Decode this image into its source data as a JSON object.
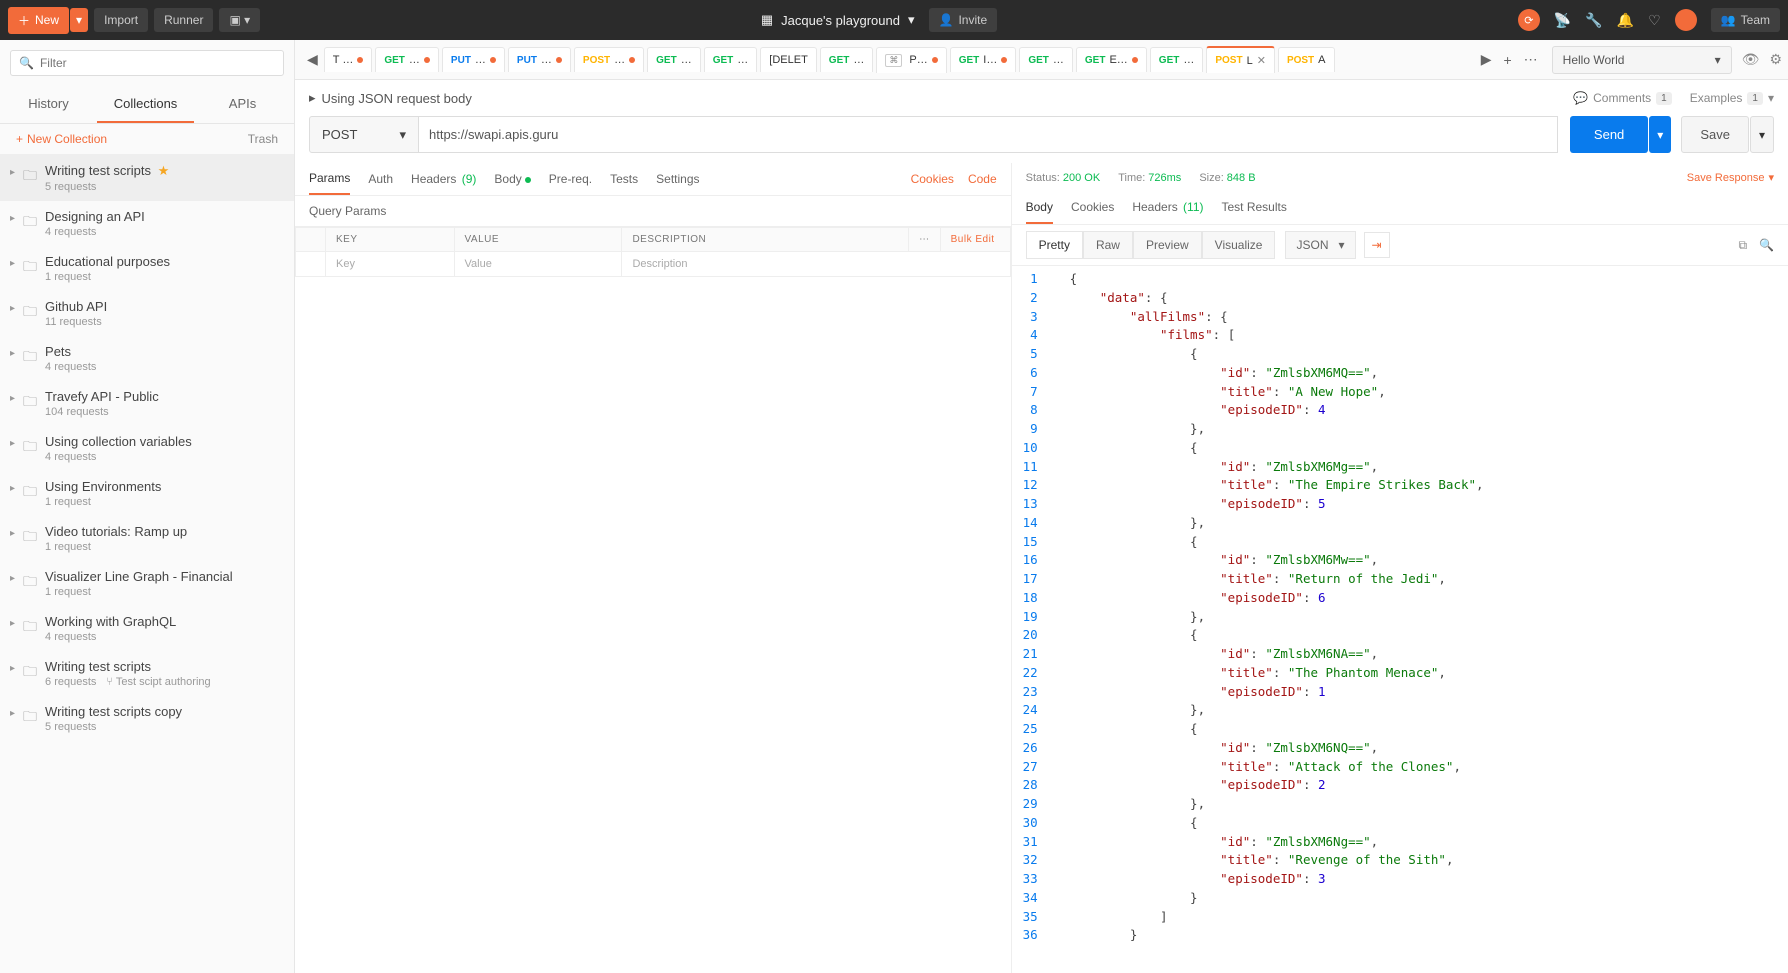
{
  "topbar": {
    "new": "New",
    "import": "Import",
    "runner": "Runner",
    "workspace": "Jacque's playground",
    "invite": "Invite",
    "team": "Team"
  },
  "sidebar": {
    "filter_ph": "Filter",
    "tabs": {
      "history": "History",
      "collections": "Collections",
      "apis": "APIs"
    },
    "new_collection": "New Collection",
    "trash": "Trash",
    "items": [
      {
        "name": "Writing test scripts",
        "sub": "5 requests",
        "star": true,
        "sel": true
      },
      {
        "name": "Designing an API",
        "sub": "4 requests"
      },
      {
        "name": "Educational purposes",
        "sub": "1 request"
      },
      {
        "name": "Github API",
        "sub": "11 requests"
      },
      {
        "name": "Pets",
        "sub": "4 requests"
      },
      {
        "name": "Travefy API - Public",
        "sub": "104 requests"
      },
      {
        "name": "Using collection variables",
        "sub": "4 requests"
      },
      {
        "name": "Using Environments",
        "sub": "1 request"
      },
      {
        "name": "Video tutorials: Ramp up",
        "sub": "1 request"
      },
      {
        "name": "Visualizer Line Graph - Financial",
        "sub": "1 request"
      },
      {
        "name": "Working with GraphQL",
        "sub": "4 requests"
      },
      {
        "name": "Writing test scripts",
        "sub": "6 requests",
        "fork": "Test scipt authoring"
      },
      {
        "name": "Writing test scripts copy",
        "sub": "5 requests"
      }
    ]
  },
  "tabs": [
    {
      "method": "NONE",
      "label": "T …",
      "dot": true
    },
    {
      "method": "GET",
      "label": "…",
      "dot": true
    },
    {
      "method": "PUT",
      "label": "…",
      "dot": true
    },
    {
      "method": "PUT",
      "label": "…",
      "dot": true
    },
    {
      "method": "POST",
      "label": "…",
      "dot": true
    },
    {
      "method": "GET",
      "label": "…"
    },
    {
      "method": "GET",
      "label": "…"
    },
    {
      "method": "DEL",
      "label": "[DELET"
    },
    {
      "method": "GET",
      "label": "…"
    },
    {
      "method": "NONE",
      "label": "P…",
      "kbd": true,
      "dot": true
    },
    {
      "method": "GET",
      "label": "I…",
      "dot": true
    },
    {
      "method": "GET",
      "label": "…"
    },
    {
      "method": "GET",
      "label": "E…",
      "dot": true
    },
    {
      "method": "GET",
      "label": "…"
    },
    {
      "method": "POST",
      "label": "L",
      "active": true,
      "close": true
    },
    {
      "method": "POST",
      "label": "A"
    }
  ],
  "env": "Hello World",
  "request": {
    "name": "Using JSON request body",
    "comments": "Comments",
    "comments_n": "1",
    "examples": "Examples",
    "examples_n": "1",
    "method": "POST",
    "url": "https://swapi.apis.guru",
    "send": "Send",
    "save": "Save",
    "tabs": {
      "params": "Params",
      "auth": "Auth",
      "headers": "Headers",
      "headers_n": "(9)",
      "body": "Body",
      "prereq": "Pre-req.",
      "tests": "Tests",
      "settings": "Settings",
      "cookies": "Cookies",
      "code": "Code"
    },
    "qparams": "Query Params",
    "th": {
      "key": "KEY",
      "value": "VALUE",
      "desc": "DESCRIPTION",
      "bulk": "Bulk Edit"
    },
    "ph": {
      "key": "Key",
      "value": "Value",
      "desc": "Description"
    }
  },
  "response": {
    "status_l": "Status:",
    "status": "200 OK",
    "time_l": "Time:",
    "time": "726ms",
    "size_l": "Size:",
    "size": "848 B",
    "save": "Save Response",
    "tabs": {
      "body": "Body",
      "cookies": "Cookies",
      "headers": "Headers",
      "headers_n": "(11)",
      "tests": "Test Results"
    },
    "views": {
      "pretty": "Pretty",
      "raw": "Raw",
      "preview": "Preview",
      "visualize": "Visualize",
      "fmt": "JSON"
    },
    "body_lines": [
      [
        [
          "brace",
          "{"
        ]
      ],
      [
        [
          "sp",
          "    "
        ],
        [
          "key",
          "\"data\""
        ],
        [
          "punc",
          ": "
        ],
        [
          "brace",
          "{"
        ]
      ],
      [
        [
          "sp",
          "        "
        ],
        [
          "key",
          "\"allFilms\""
        ],
        [
          "punc",
          ": "
        ],
        [
          "brace",
          "{"
        ]
      ],
      [
        [
          "sp",
          "            "
        ],
        [
          "key",
          "\"films\""
        ],
        [
          "punc",
          ": "
        ],
        [
          "brace",
          "["
        ]
      ],
      [
        [
          "sp",
          "                "
        ],
        [
          "brace",
          "{"
        ]
      ],
      [
        [
          "sp",
          "                    "
        ],
        [
          "key",
          "\"id\""
        ],
        [
          "punc",
          ": "
        ],
        [
          "str",
          "\"ZmlsbXM6MQ==\""
        ],
        [
          "punc",
          ","
        ]
      ],
      [
        [
          "sp",
          "                    "
        ],
        [
          "key",
          "\"title\""
        ],
        [
          "punc",
          ": "
        ],
        [
          "str",
          "\"A New Hope\""
        ],
        [
          "punc",
          ","
        ]
      ],
      [
        [
          "sp",
          "                    "
        ],
        [
          "key",
          "\"episodeID\""
        ],
        [
          "punc",
          ": "
        ],
        [
          "num",
          "4"
        ]
      ],
      [
        [
          "sp",
          "                "
        ],
        [
          "brace",
          "}"
        ],
        [
          "punc",
          ","
        ]
      ],
      [
        [
          "sp",
          "                "
        ],
        [
          "brace",
          "{"
        ]
      ],
      [
        [
          "sp",
          "                    "
        ],
        [
          "key",
          "\"id\""
        ],
        [
          "punc",
          ": "
        ],
        [
          "str",
          "\"ZmlsbXM6Mg==\""
        ],
        [
          "punc",
          ","
        ]
      ],
      [
        [
          "sp",
          "                    "
        ],
        [
          "key",
          "\"title\""
        ],
        [
          "punc",
          ": "
        ],
        [
          "str",
          "\"The Empire Strikes Back\""
        ],
        [
          "punc",
          ","
        ]
      ],
      [
        [
          "sp",
          "                    "
        ],
        [
          "key",
          "\"episodeID\""
        ],
        [
          "punc",
          ": "
        ],
        [
          "num",
          "5"
        ]
      ],
      [
        [
          "sp",
          "                "
        ],
        [
          "brace",
          "}"
        ],
        [
          "punc",
          ","
        ]
      ],
      [
        [
          "sp",
          "                "
        ],
        [
          "brace",
          "{"
        ]
      ],
      [
        [
          "sp",
          "                    "
        ],
        [
          "key",
          "\"id\""
        ],
        [
          "punc",
          ": "
        ],
        [
          "str",
          "\"ZmlsbXM6Mw==\""
        ],
        [
          "punc",
          ","
        ]
      ],
      [
        [
          "sp",
          "                    "
        ],
        [
          "key",
          "\"title\""
        ],
        [
          "punc",
          ": "
        ],
        [
          "str",
          "\"Return of the Jedi\""
        ],
        [
          "punc",
          ","
        ]
      ],
      [
        [
          "sp",
          "                    "
        ],
        [
          "key",
          "\"episodeID\""
        ],
        [
          "punc",
          ": "
        ],
        [
          "num",
          "6"
        ]
      ],
      [
        [
          "sp",
          "                "
        ],
        [
          "brace",
          "}"
        ],
        [
          "punc",
          ","
        ]
      ],
      [
        [
          "sp",
          "                "
        ],
        [
          "brace",
          "{"
        ]
      ],
      [
        [
          "sp",
          "                    "
        ],
        [
          "key",
          "\"id\""
        ],
        [
          "punc",
          ": "
        ],
        [
          "str",
          "\"ZmlsbXM6NA==\""
        ],
        [
          "punc",
          ","
        ]
      ],
      [
        [
          "sp",
          "                    "
        ],
        [
          "key",
          "\"title\""
        ],
        [
          "punc",
          ": "
        ],
        [
          "str",
          "\"The Phantom Menace\""
        ],
        [
          "punc",
          ","
        ]
      ],
      [
        [
          "sp",
          "                    "
        ],
        [
          "key",
          "\"episodeID\""
        ],
        [
          "punc",
          ": "
        ],
        [
          "num",
          "1"
        ]
      ],
      [
        [
          "sp",
          "                "
        ],
        [
          "brace",
          "}"
        ],
        [
          "punc",
          ","
        ]
      ],
      [
        [
          "sp",
          "                "
        ],
        [
          "brace",
          "{"
        ]
      ],
      [
        [
          "sp",
          "                    "
        ],
        [
          "key",
          "\"id\""
        ],
        [
          "punc",
          ": "
        ],
        [
          "str",
          "\"ZmlsbXM6NQ==\""
        ],
        [
          "punc",
          ","
        ]
      ],
      [
        [
          "sp",
          "                    "
        ],
        [
          "key",
          "\"title\""
        ],
        [
          "punc",
          ": "
        ],
        [
          "str",
          "\"Attack of the Clones\""
        ],
        [
          "punc",
          ","
        ]
      ],
      [
        [
          "sp",
          "                    "
        ],
        [
          "key",
          "\"episodeID\""
        ],
        [
          "punc",
          ": "
        ],
        [
          "num",
          "2"
        ]
      ],
      [
        [
          "sp",
          "                "
        ],
        [
          "brace",
          "}"
        ],
        [
          "punc",
          ","
        ]
      ],
      [
        [
          "sp",
          "                "
        ],
        [
          "brace",
          "{"
        ]
      ],
      [
        [
          "sp",
          "                    "
        ],
        [
          "key",
          "\"id\""
        ],
        [
          "punc",
          ": "
        ],
        [
          "str",
          "\"ZmlsbXM6Ng==\""
        ],
        [
          "punc",
          ","
        ]
      ],
      [
        [
          "sp",
          "                    "
        ],
        [
          "key",
          "\"title\""
        ],
        [
          "punc",
          ": "
        ],
        [
          "str",
          "\"Revenge of the Sith\""
        ],
        [
          "punc",
          ","
        ]
      ],
      [
        [
          "sp",
          "                    "
        ],
        [
          "key",
          "\"episodeID\""
        ],
        [
          "punc",
          ": "
        ],
        [
          "num",
          "3"
        ]
      ],
      [
        [
          "sp",
          "                "
        ],
        [
          "brace",
          "}"
        ]
      ],
      [
        [
          "sp",
          "            "
        ],
        [
          "brace",
          "]"
        ]
      ],
      [
        [
          "sp",
          "        "
        ],
        [
          "brace",
          "}"
        ]
      ]
    ]
  }
}
